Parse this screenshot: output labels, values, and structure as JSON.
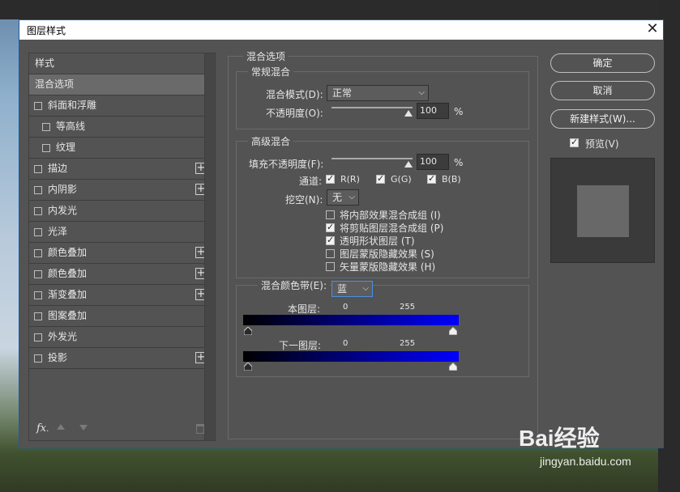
{
  "dialog": {
    "title": "图层样式",
    "close": "✕"
  },
  "styles_list": {
    "header": "样式",
    "items": [
      {
        "label": "混合选项",
        "checkbox": false,
        "plus": false,
        "selected": true,
        "indent": 0
      },
      {
        "label": "斜面和浮雕",
        "checkbox": true,
        "plus": false,
        "indent": 0
      },
      {
        "label": "等高线",
        "checkbox": true,
        "plus": false,
        "indent": 1
      },
      {
        "label": "纹理",
        "checkbox": true,
        "plus": false,
        "indent": 1
      },
      {
        "label": "描边",
        "checkbox": true,
        "plus": true,
        "indent": 0
      },
      {
        "label": "内阴影",
        "checkbox": true,
        "plus": true,
        "indent": 0
      },
      {
        "label": "内发光",
        "checkbox": true,
        "plus": false,
        "indent": 0
      },
      {
        "label": "光泽",
        "checkbox": true,
        "plus": false,
        "indent": 0
      },
      {
        "label": "颜色叠加",
        "checkbox": true,
        "plus": true,
        "indent": 0
      },
      {
        "label": "颜色叠加",
        "checkbox": true,
        "plus": true,
        "indent": 0
      },
      {
        "label": "渐变叠加",
        "checkbox": true,
        "plus": true,
        "indent": 0
      },
      {
        "label": "图案叠加",
        "checkbox": true,
        "plus": false,
        "indent": 0
      },
      {
        "label": "外发光",
        "checkbox": true,
        "plus": false,
        "indent": 0
      },
      {
        "label": "投影",
        "checkbox": true,
        "plus": true,
        "indent": 0
      }
    ],
    "footer": {
      "fx": "fx",
      "fx_suffix": "."
    }
  },
  "blend_options": {
    "title": "混合选项",
    "general": {
      "title": "常规混合",
      "mode_label": "混合模式(D):",
      "mode_value": "正常",
      "opacity_label": "不透明度(O):",
      "opacity_value": "100",
      "opacity_unit": "%"
    },
    "advanced": {
      "title": "高级混合",
      "fill_label": "填充不透明度(F):",
      "fill_value": "100",
      "fill_unit": "%",
      "channels_label": "通道:",
      "channel_r": "R(R)",
      "channel_g": "G(G)",
      "channel_b": "B(B)",
      "knockout_label": "挖空(N):",
      "knockout_value": "无",
      "options": [
        {
          "label": "将内部效果混合成组 (I)",
          "checked": false
        },
        {
          "label": "将剪贴图层混合成组 (P)",
          "checked": true
        },
        {
          "label": "透明形状图层 (T)",
          "checked": true
        },
        {
          "label": "图层蒙版隐藏效果 (S)",
          "checked": false
        },
        {
          "label": "矢量蒙版隐藏效果 (H)",
          "checked": false
        }
      ]
    },
    "blend_if": {
      "label": "混合颜色带(E):",
      "value": "蓝",
      "this_layer_label": "本图层:",
      "this_layer_min": "0",
      "this_layer_max": "255",
      "under_layer_label": "下一图层:",
      "under_layer_min": "0",
      "under_layer_max": "255"
    }
  },
  "buttons": {
    "ok": "确定",
    "cancel": "取消",
    "new_style": "新建样式(W)...",
    "preview_label": "预览(V)"
  },
  "watermark": {
    "brand": "Bai经验",
    "url": "jingyan.baidu.com"
  }
}
